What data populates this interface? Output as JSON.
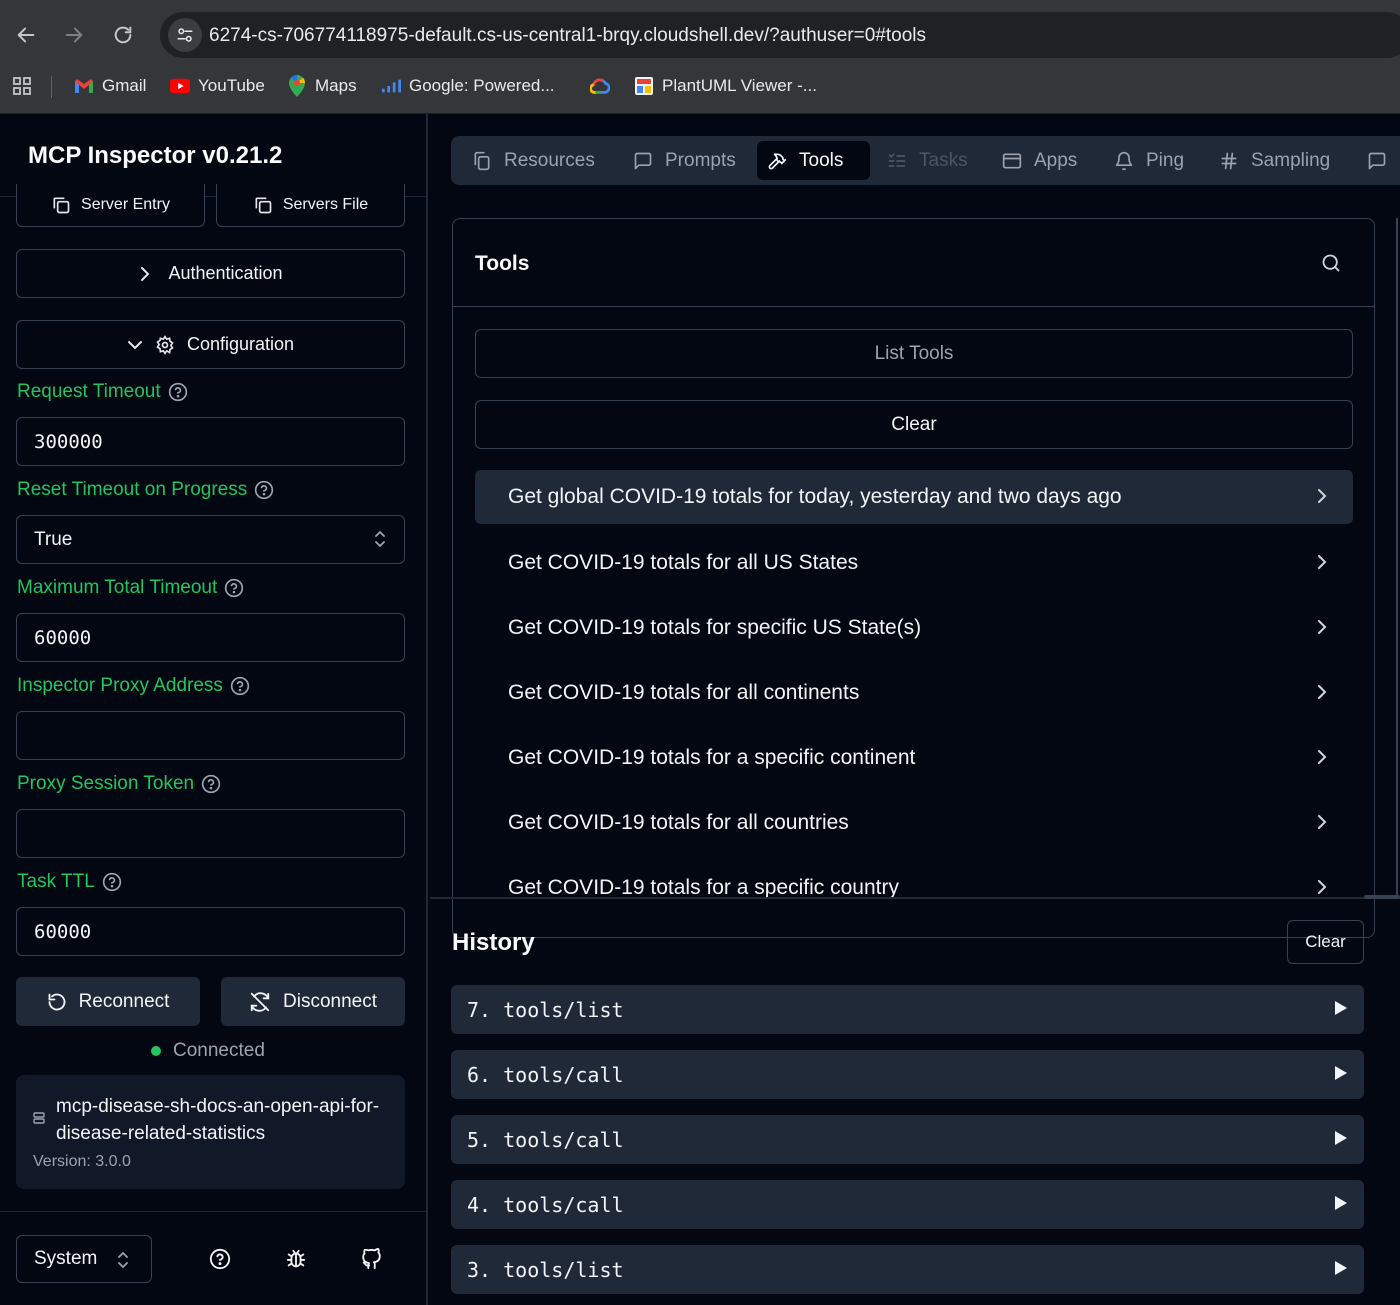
{
  "browser": {
    "url": "6274-cs-706774118975-default.cs-us-central1-brqy.cloudshell.dev/?authuser=0#tools",
    "bookmarks": [
      {
        "label": "Gmail",
        "icon": "gmail-icon"
      },
      {
        "label": "YouTube",
        "icon": "youtube-icon"
      },
      {
        "label": "Maps",
        "icon": "maps-icon"
      },
      {
        "label": "Google: Powered...",
        "icon": "bar-chart-icon"
      },
      {
        "label": "",
        "icon": "google-cloud-icon"
      },
      {
        "label": "PlantUML Viewer -...",
        "icon": "plantuml-icon"
      }
    ]
  },
  "sidebar": {
    "title": "MCP Inspector v0.21.2",
    "server_entry_label": "Server Entry",
    "servers_file_label": "Servers File",
    "authentication_label": "Authentication",
    "configuration_label": "Configuration",
    "fields": {
      "request_timeout": {
        "label": "Request Timeout",
        "value": "300000"
      },
      "reset_timeout": {
        "label": "Reset Timeout on Progress",
        "value": "True"
      },
      "max_total_timeout": {
        "label": "Maximum Total Timeout",
        "value": "60000"
      },
      "proxy_address": {
        "label": "Inspector Proxy Address",
        "value": ""
      },
      "proxy_token": {
        "label": "Proxy Session Token",
        "value": ""
      },
      "task_ttl": {
        "label": "Task TTL",
        "value": "60000"
      }
    },
    "reconnect_label": "Reconnect",
    "disconnect_label": "Disconnect",
    "status": "Connected",
    "server": {
      "name": "mcp-disease-sh-docs-an-open-api-for-disease-related-statistics",
      "version": "Version: 3.0.0"
    },
    "theme": "System"
  },
  "tabs": [
    {
      "label": "Resources",
      "icon": "resources-icon"
    },
    {
      "label": "Prompts",
      "icon": "prompts-icon"
    },
    {
      "label": "Tools",
      "icon": "hammer-icon"
    },
    {
      "label": "Tasks",
      "icon": "tasks-icon"
    },
    {
      "label": "Apps",
      "icon": "apps-icon"
    },
    {
      "label": "Ping",
      "icon": "bell-icon"
    },
    {
      "label": "Sampling",
      "icon": "hash-icon"
    }
  ],
  "tools": {
    "title": "Tools",
    "list_label": "List Tools",
    "clear_label": "Clear",
    "items": [
      "Get global COVID-19 totals for today, yesterday and two days ago",
      "Get COVID-19 totals for all US States",
      "Get COVID-19 totals for specific US State(s)",
      "Get COVID-19 totals for all continents",
      "Get COVID-19 totals for a specific continent",
      "Get COVID-19 totals for all countries",
      "Get COVID-19 totals for a specific country"
    ]
  },
  "history": {
    "title": "History",
    "clear_label": "Clear",
    "items": [
      "7. tools/list",
      "6. tools/call",
      "5. tools/call",
      "4. tools/call",
      "3. tools/list"
    ]
  },
  "colors": {
    "accent_green": "#22c55e",
    "background": "#030712",
    "panel": "#1f2937"
  }
}
